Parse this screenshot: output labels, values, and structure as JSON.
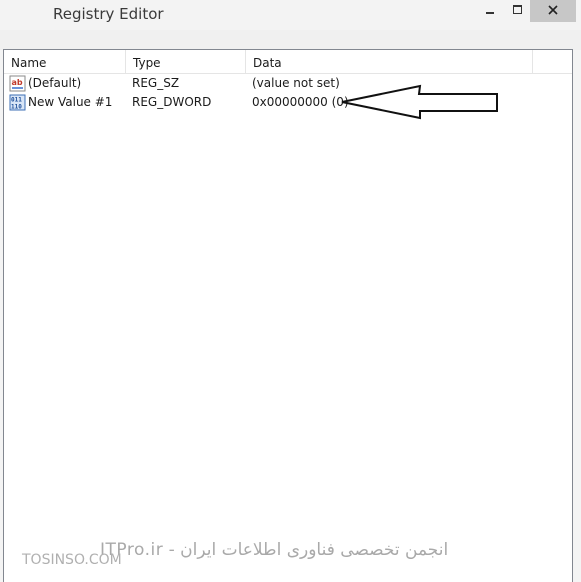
{
  "window": {
    "title": "Registry Editor"
  },
  "columns": {
    "name": "Name",
    "type": "Type",
    "data": "Data"
  },
  "values": [
    {
      "name": "(Default)",
      "type": "REG_SZ",
      "data": "(value not set)",
      "icon": "string-value-icon"
    },
    {
      "name": "New Value #1",
      "type": "REG_DWORD",
      "data": "0x00000000 (0)",
      "icon": "binary-value-icon"
    }
  ],
  "watermark": {
    "site": "TOSINSO.COM",
    "text": "انجمن تخصصی فناوری اطلاعات ایران - ITPro.ir"
  }
}
